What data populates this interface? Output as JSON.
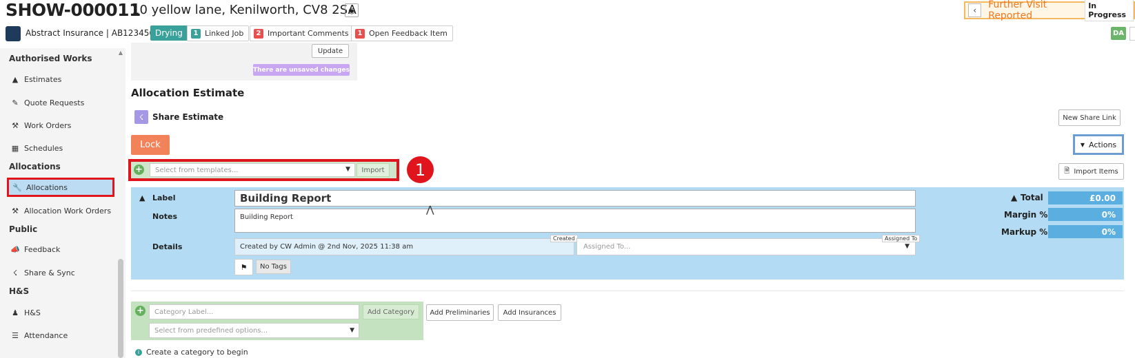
{
  "header": {
    "job_id": "SHOW-000011",
    "address": "10 yellow lane, Kenilworth, CV8 2SA",
    "status_text": "Further Visit Reported",
    "status_badge": "In Progress",
    "client": "Abstract Insurance | AB123456",
    "tag_drying": "Drying",
    "chips": [
      {
        "count": "1",
        "label": "Linked Job",
        "color": "#3aa09a"
      },
      {
        "count": "2",
        "label": "Important Comments",
        "color": "#e85050"
      },
      {
        "count": "1",
        "label": "Open Feedback Item",
        "color": "#e85050"
      }
    ],
    "user_initials": "DA"
  },
  "sidebar": {
    "sections": [
      {
        "title": "Authorised Works"
      },
      {
        "title": "Allocations"
      },
      {
        "title": "Public"
      },
      {
        "title": "H&S"
      }
    ],
    "items": [
      {
        "label": "Estimates",
        "icon": "hardhat-icon"
      },
      {
        "label": "Quote Requests",
        "icon": "brush-icon"
      },
      {
        "label": "Work Orders",
        "icon": "hammer-icon"
      },
      {
        "label": "Schedules",
        "icon": "calendar-icon"
      },
      {
        "label": "Allocations",
        "icon": "wrench-icon"
      },
      {
        "label": "Allocation Work Orders",
        "icon": "hammer-icon"
      },
      {
        "label": "Feedback",
        "icon": "megaphone-icon"
      },
      {
        "label": "Share & Sync",
        "icon": "share-icon"
      },
      {
        "label": "H&S",
        "icon": "person-icon"
      },
      {
        "label": "Attendance",
        "icon": "list-icon"
      }
    ]
  },
  "main": {
    "update_label": "Update",
    "unsaved_label": "There are unsaved changes",
    "title": "Allocation Estimate",
    "share_label": "Share Estimate",
    "new_share_link": "New Share Link",
    "lock_label": "Lock",
    "actions_label": "Actions",
    "template_placeholder": "Select from templates...",
    "import_label": "Import",
    "step_number": "1",
    "import_items_label": "Import Items",
    "allocation": {
      "label_key": "Label",
      "label_value": "Building Report",
      "notes_key": "Notes",
      "notes_value": "Building Report",
      "details_key": "Details",
      "created_text": "Created by  CW Admin @ 2nd Nov, 2025 11:38 am",
      "created_tag": "Created",
      "assigned_placeholder": "Assigned To...",
      "assigned_tag": "Assigned To",
      "no_tags": "No Tags",
      "total_label": "Total",
      "total_value": "£0.00",
      "margin_label": "Margin %",
      "margin_value": "0%",
      "markup_label": "Markup %",
      "markup_value": "0%"
    },
    "category": {
      "label_placeholder": "Category Label...",
      "add_category": "Add Category",
      "add_preliminaries": "Add Preliminaries",
      "add_insurances": "Add Insurances",
      "predefined_placeholder": "Select from predefined options...",
      "hint": "Create a category to begin"
    }
  },
  "colors": {
    "accent_red": "#e0141c",
    "panel_blue": "#b3dcf4",
    "total_blue": "#5aaee0",
    "lock_orange": "#f2825a",
    "status_orange": "#f07820",
    "green_panel": "#c4e2c0"
  }
}
